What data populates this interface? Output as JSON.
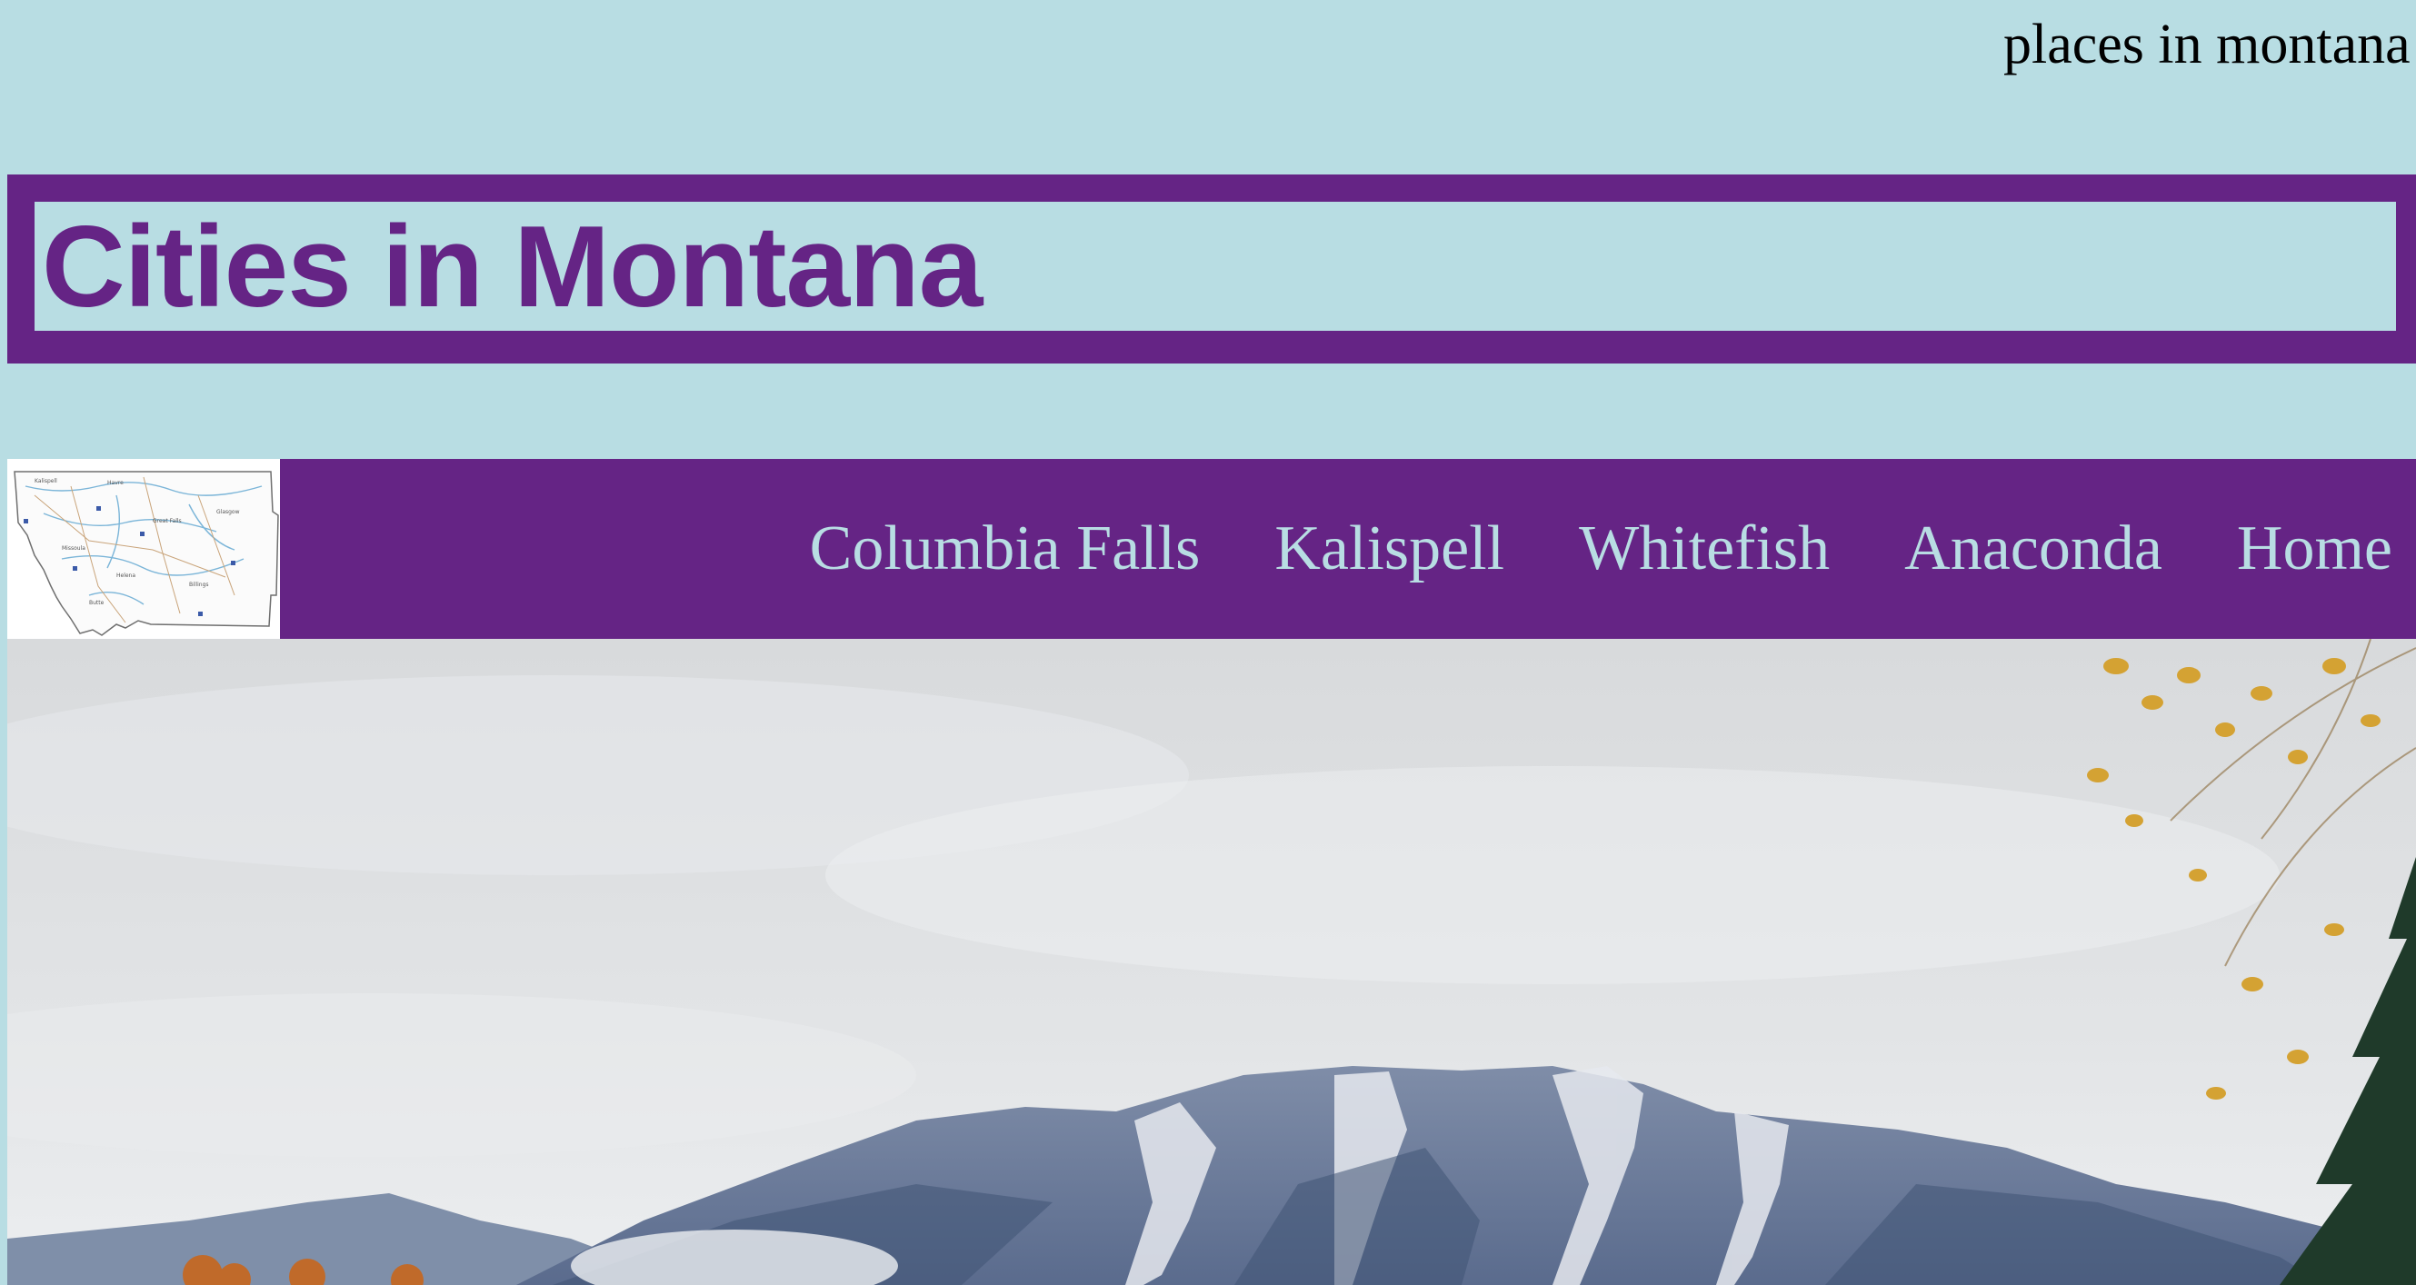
{
  "header": {
    "top_text": "places in montana",
    "title": "Cities in Montana"
  },
  "nav": {
    "logo_icon": "montana-map-icon",
    "links": [
      {
        "label": "Columbia Falls"
      },
      {
        "label": "Kalispell"
      },
      {
        "label": "Whitefish"
      },
      {
        "label": "Anaconda"
      },
      {
        "label": "Home"
      }
    ]
  },
  "colors": {
    "background": "#b8dde3",
    "accent": "#652485"
  }
}
